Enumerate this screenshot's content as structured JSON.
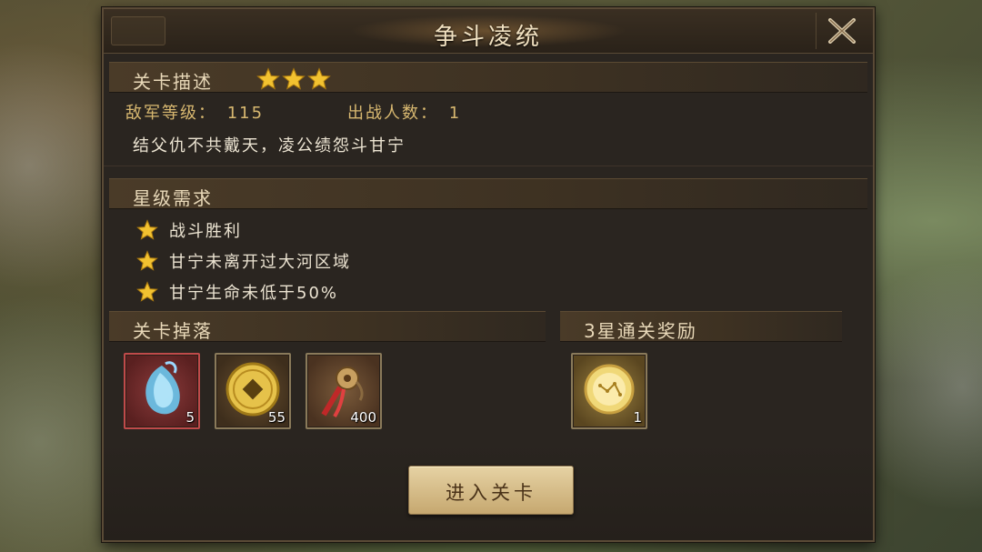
{
  "dialog": {
    "title": "争斗凌统"
  },
  "stage_description": {
    "label": "关卡描述",
    "stars": 3,
    "enemy_level_label": "敌军等级：",
    "enemy_level_value": "115",
    "troop_count_label": "出战人数：",
    "troop_count_value": "1",
    "description": "结父仇不共戴天，凌公绩怨斗甘宁"
  },
  "star_requirements": {
    "label": "星级需求",
    "items": [
      {
        "text": "战斗胜利"
      },
      {
        "text": "甘宁未离开过大河区域"
      },
      {
        "text": "甘宁生命未低于50%"
      }
    ]
  },
  "stage_drops": {
    "label": "关卡掉落",
    "items": [
      {
        "icon": "blue-spirit-orb-icon",
        "count": "5",
        "rarity_color": "#c04a4a"
      },
      {
        "icon": "gold-coin-icon",
        "count": "55",
        "rarity_color": "#8a7a5a"
      },
      {
        "icon": "bell-token-icon",
        "count": "400",
        "rarity_color": "#8a7a5a"
      }
    ]
  },
  "three_star_reward": {
    "label": "3星通关奖励",
    "items": [
      {
        "icon": "golden-orb-icon",
        "count": "1",
        "rarity_color": "#8a7a5a"
      }
    ]
  },
  "enter_button": {
    "label": "进入关卡"
  },
  "colors": {
    "panel": "#2a2520",
    "accent_gold": "#d8b870",
    "button": "#e6d2a4"
  }
}
